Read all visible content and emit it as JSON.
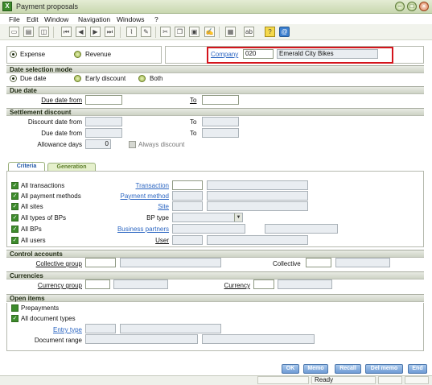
{
  "window": {
    "title": "Payment proposals",
    "buttons": [
      "–",
      "□",
      "×"
    ]
  },
  "menu": [
    "File",
    "Edit",
    "Window",
    "Navigation",
    "Windows",
    "?"
  ],
  "toolbar": {
    "icons": [
      "new-icon",
      "print-icon",
      "preview-icon",
      "first-icon",
      "previous-icon",
      "next-icon",
      "last-icon",
      "attach-icon",
      "comment-icon",
      "cut-icon",
      "copy-icon",
      "paste-icon",
      "sign-icon",
      "doc-icon",
      "text-icon",
      "help-icon",
      "web-icon"
    ]
  },
  "type_choice": {
    "expense": "Expense",
    "revenue": "Revenue",
    "selected": "Expense"
  },
  "company": {
    "label": "Company",
    "code": "020",
    "name": "Emerald City Bikes"
  },
  "date_mode": {
    "title": "Date selection mode",
    "options": [
      "Due date",
      "Early discount",
      "Both"
    ],
    "selected": "Due date"
  },
  "due_date": {
    "title": "Due date",
    "from_label": "Due date from",
    "to_label": "To",
    "from_value": "",
    "to_value": ""
  },
  "settlement": {
    "title": "Settlement discount",
    "discount_from_label": "Discount date from",
    "due_from_label": "Due date from",
    "to_label": "To",
    "allowance_label": "Allowance days",
    "allowance_value": "0",
    "always_discount_label": "Always discount"
  },
  "tabs": {
    "criteria": "Criteria",
    "generation": "Generation"
  },
  "criteria": {
    "all_transactions": "All transactions",
    "all_payment_methods": "All payment methods",
    "all_sites": "All sites",
    "all_bp_types": "All types of BPs",
    "all_bps": "All BPs",
    "all_users": "All users",
    "transaction_link": "Transaction",
    "payment_method_link": "Payment method",
    "site_link": "Site",
    "bp_type_label": "BP type",
    "business_partners_link": "Business partners",
    "user_label": "User"
  },
  "control_accounts": {
    "title": "Control accounts",
    "collective_group_label": "Collective group",
    "collective_label": "Collective"
  },
  "currencies": {
    "title": "Currencies",
    "currency_group_label": "Currency group",
    "currency_label": "Currency"
  },
  "open_items": {
    "title": "Open items",
    "prepayments_label": "Prepayments",
    "all_document_types_label": "All document types",
    "entry_type_link": "Entry type",
    "document_range_label": "Document range"
  },
  "bottom_buttons": [
    "OK",
    "Memo",
    "Recall",
    "Del memo",
    "End"
  ],
  "status": {
    "text": "Ready"
  }
}
